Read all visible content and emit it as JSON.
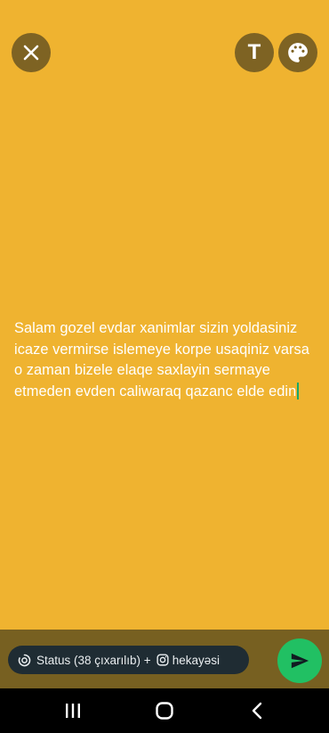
{
  "editor": {
    "background_color": "#efb330",
    "status_text": "Salam gozel evdar xanimlar sizin  yoldasiniz icaze vermirse islemeye korpe usaqiniz varsa o zaman bizele elaqe saxlayin sermaye etmeden evden caliwaraq qazanc elde edin",
    "text_color": "#ffffff",
    "cursor_color": "#17a869"
  },
  "toolbar": {
    "close_icon": "close-icon",
    "text_tool_label": "T",
    "palette_icon": "palette-icon"
  },
  "footer": {
    "audience_prefix": "Status (38 çıxarılıb) +",
    "audience_suffix": "hekayəsi",
    "status_icon": "status-ring-icon",
    "instagram_icon": "instagram-icon",
    "send_icon": "send-icon",
    "send_color": "#21c063"
  },
  "system_nav": {
    "recent_icon": "recent-apps-icon",
    "home_icon": "home-icon",
    "back_icon": "back-icon"
  }
}
